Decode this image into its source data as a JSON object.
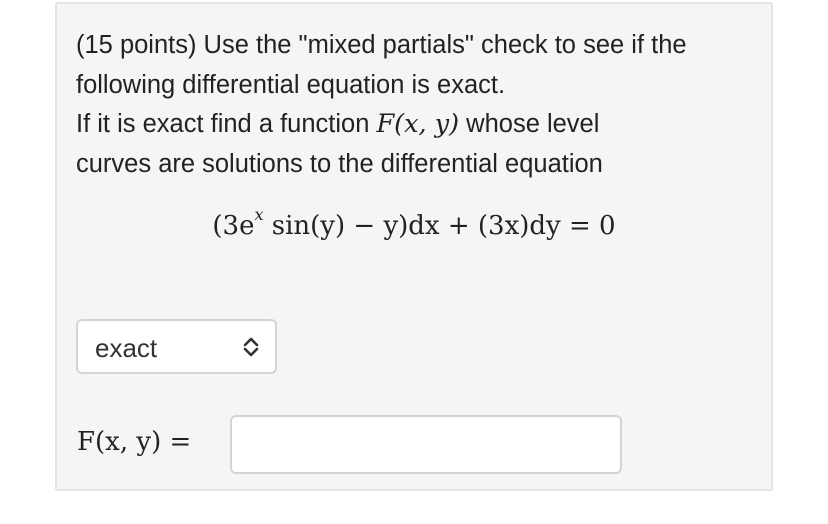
{
  "question": {
    "line1": "(15 points) Use the \"mixed partials\" check to see if the",
    "line2": "following differential equation is exact.",
    "line3_before": "If it is exact find a function ",
    "line3_math": "F(x, y)",
    "line3_after": " whose level",
    "line4": "curves are solutions to the differential equation"
  },
  "equation": {
    "lead": "(3e",
    "superscript": "x",
    "rest": " sin(y) − y)dx + (3x)dy = 0"
  },
  "exactness_select": {
    "selected": "exact",
    "icon": "up-down-chevron-icon"
  },
  "answer": {
    "label": "F(x, y) =",
    "value": "",
    "placeholder": ""
  }
}
